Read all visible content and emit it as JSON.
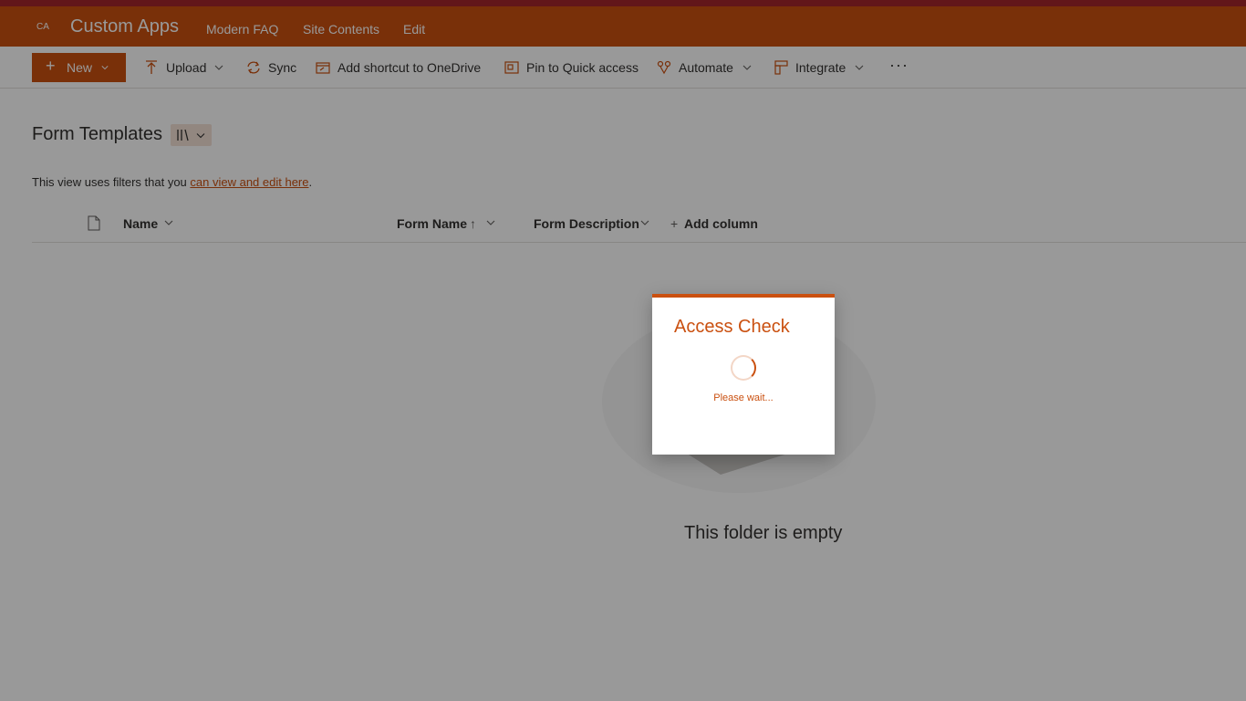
{
  "site": {
    "logo_initials": "CA",
    "title": "Custom Apps",
    "nav": [
      "Modern FAQ",
      "Site Contents",
      "Edit"
    ]
  },
  "commandbar": {
    "new_label": "New",
    "upload_label": "Upload",
    "sync_label": "Sync",
    "shortcut_label": "Add shortcut to OneDrive",
    "pin_label": "Pin to Quick access",
    "automate_label": "Automate",
    "integrate_label": "Integrate",
    "more_label": "···"
  },
  "library": {
    "title": "Form Templates",
    "filter_text": "This view uses filters that you ",
    "filter_link": "can view and edit here",
    "filter_end": ".",
    "columns": {
      "name": "Name",
      "form_name": "Form Name",
      "form_name_sort": "↑",
      "form_description": "Form Description",
      "add_column": "Add column",
      "add_plus": "+"
    },
    "empty_message": "This folder is empty"
  },
  "dialog": {
    "title": "Access Check",
    "message": "Please wait..."
  },
  "colors": {
    "accent": "#ca5010",
    "top_strip": "#a4262c",
    "overlay": "rgba(0,0,0,0.4)"
  },
  "icons": {
    "plus": "plus-icon",
    "upload": "upload-icon",
    "sync": "sync-icon",
    "shortcut": "add-shortcut-icon",
    "pin": "pin-icon",
    "automate": "automate-icon",
    "integrate": "integrate-icon",
    "file": "file-icon",
    "spinner": "loading-spinner-icon"
  }
}
